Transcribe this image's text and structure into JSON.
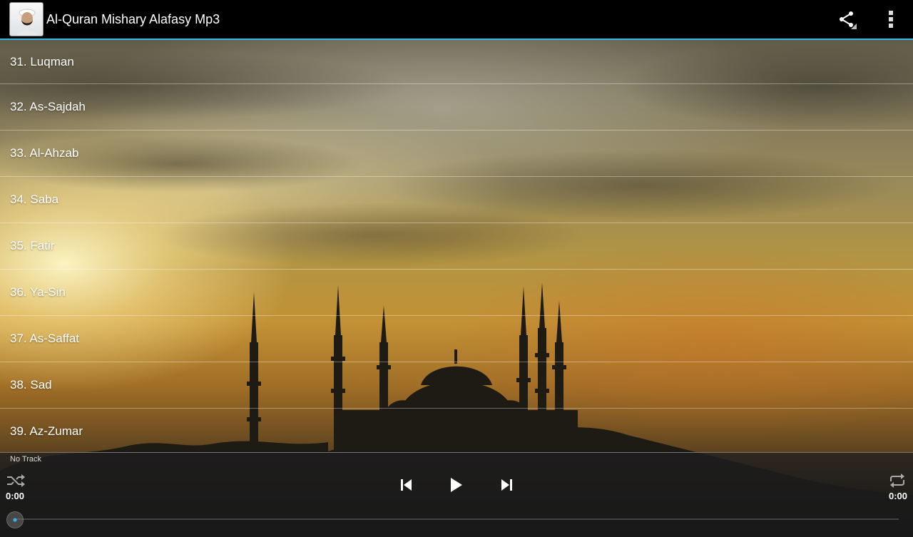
{
  "app": {
    "title": "Al-Quran Mishary Alafasy Mp3",
    "accent_color": "#33b5e5"
  },
  "actionbar": {
    "icons": [
      "app-logo",
      "share-icon",
      "overflow-menu-icon"
    ]
  },
  "tracks": [
    "31. Luqman",
    "32. As-Sajdah",
    "33. Al-Ahzab",
    "34. Saba",
    "35. Fatir",
    "36. Ya-Sin",
    "37. As-Saffat",
    "38. Sad",
    "39. Az-Zumar"
  ],
  "player": {
    "now_playing": "No Track",
    "elapsed": "0:00",
    "duration": "0:00",
    "progress": 0,
    "icons": [
      "shuffle-icon",
      "previous-icon",
      "play-icon",
      "next-icon",
      "repeat-icon"
    ]
  }
}
